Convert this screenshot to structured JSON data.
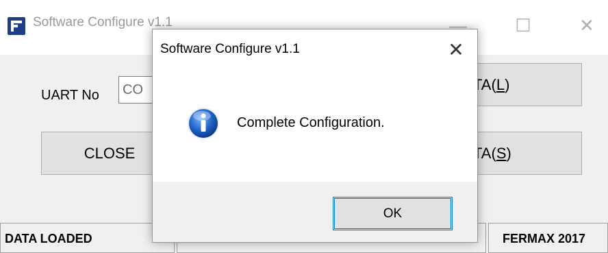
{
  "main_window": {
    "title": "Software Configure v1.1",
    "controls": {
      "minimize": "—",
      "maximize": "☐",
      "close": "✕"
    },
    "uart_label": "UART No",
    "uart_value": "CO",
    "close_button": "CLOSE",
    "load_button": {
      "prefix": "TA(",
      "mnemonic": "L",
      "suffix": ")"
    },
    "save_button": {
      "prefix": "TA(",
      "mnemonic": "S",
      "suffix": ")"
    },
    "status": {
      "left": "DATA LOADED",
      "middle": "",
      "right": "FERMAX 2017"
    }
  },
  "dialog": {
    "title": "Software Configure v1.1",
    "close": "✕",
    "message": "Complete Configuration.",
    "ok_label": "OK",
    "icon": "info-icon"
  },
  "colors": {
    "accent": "#0078d7",
    "icon_blue": "#1b5fc1",
    "app_icon": "#1f3f84"
  }
}
